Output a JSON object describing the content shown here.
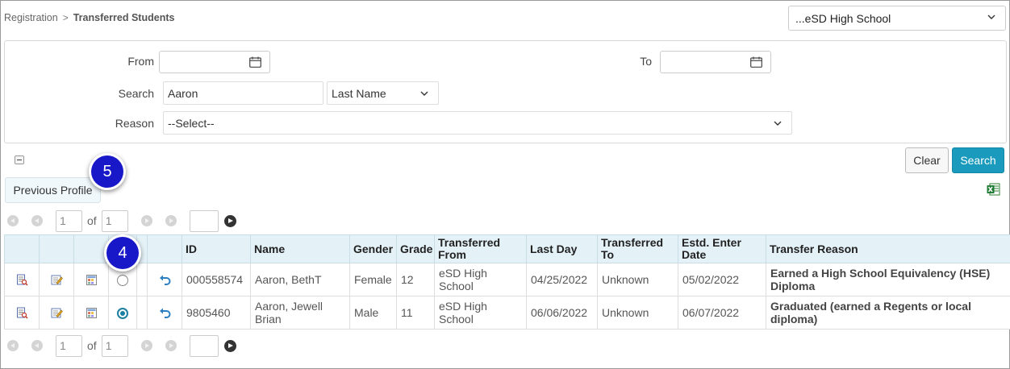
{
  "breadcrumb": {
    "parent": "Registration",
    "separator": ">",
    "current": "Transferred Students"
  },
  "school_select": {
    "value": "...eSD High School"
  },
  "filters": {
    "from_label": "From",
    "to_label": "To",
    "from_value": "",
    "to_value": "",
    "search_label": "Search",
    "search_value": "Aaron",
    "search_field": "Last Name",
    "reason_label": "Reason",
    "reason_value": "--Select--"
  },
  "buttons": {
    "clear": "Clear",
    "search": "Search",
    "previous_profile": "Previous Profile"
  },
  "callouts": {
    "five": "5",
    "four": "4"
  },
  "pager": {
    "page": "1",
    "of_label": "of",
    "total": "1",
    "goto": ""
  },
  "table": {
    "columns": [
      "",
      "",
      "",
      "",
      "",
      "ID",
      "Name",
      "Gender",
      "Grade",
      "Transferred From",
      "Last Day",
      "Transferred To",
      "Estd. Enter Date",
      "Transfer Reason"
    ],
    "rows": [
      {
        "id": "000558574",
        "name": "Aaron, BethT",
        "gender": "Female",
        "grade": "12",
        "from": "eSD High School",
        "last_day": "04/25/2022",
        "to": "Unknown",
        "enter_date": "05/02/2022",
        "reason": "Earned a High School Equivalency (HSE) Diploma",
        "selected": false
      },
      {
        "id": "9805460",
        "name": "Aaron, Jewell Brian",
        "gender": "Male",
        "grade": "11",
        "from": "eSD High School",
        "last_day": "06/06/2022",
        "to": "Unknown",
        "enter_date": "06/07/2022",
        "reason": "Graduated (earned a Regents or local diploma)",
        "selected": true
      }
    ]
  },
  "icons": {
    "row": [
      "view-document-icon",
      "edit-icon",
      "grid-icon",
      "select-radio",
      "undo-transfer-icon"
    ],
    "excel": "excel-export-icon",
    "calendar": "calendar-icon"
  },
  "colors": {
    "accent": "#1a9bbd",
    "header_bg": "#e4f2f8",
    "callout": "#1818c9"
  }
}
